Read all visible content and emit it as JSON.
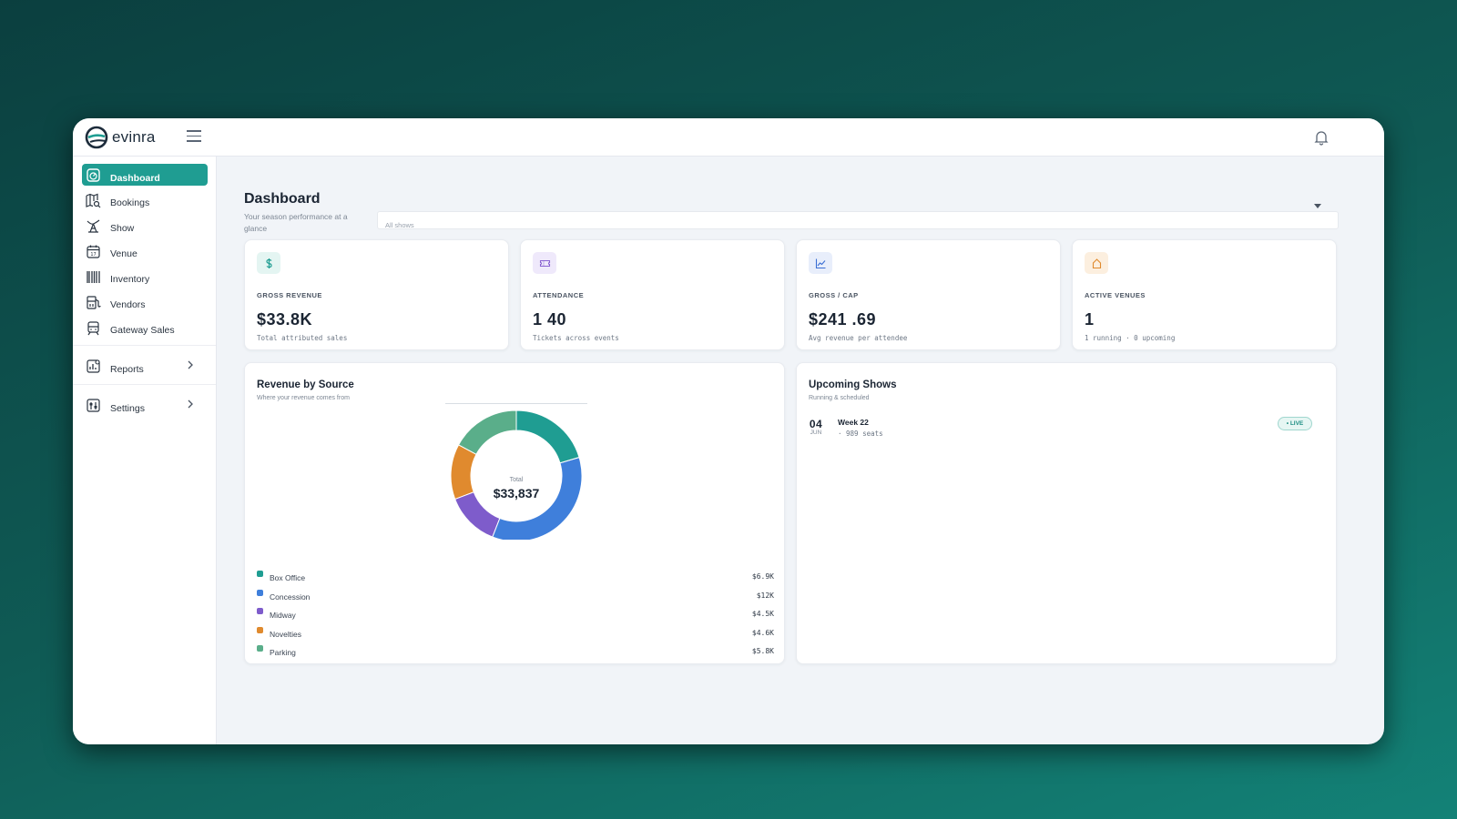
{
  "app": {
    "name": "evinra"
  },
  "sidebar": {
    "items": [
      {
        "label": "Dashboard",
        "icon": "dashboard-icon",
        "active": true
      },
      {
        "label": "Bookings",
        "icon": "map-search-icon"
      },
      {
        "label": "Show",
        "icon": "ferris-wheel-icon"
      },
      {
        "label": "Venue",
        "icon": "calendar-icon"
      },
      {
        "label": "Inventory",
        "icon": "barcode-icon"
      },
      {
        "label": "Vendors",
        "icon": "vendor-pump-icon"
      },
      {
        "label": "Gateway Sales",
        "icon": "tram-icon"
      }
    ],
    "groups": [
      {
        "label": "Reports",
        "icon": "report-chart-icon",
        "expandable": true
      },
      {
        "label": "Settings",
        "icon": "settings-sliders-icon",
        "expandable": true
      }
    ]
  },
  "header": {
    "title": "Dashboard",
    "subtitle": "Your season performance at a glance",
    "filter_value": "All shows"
  },
  "kpis": [
    {
      "label": "GROSS REVENUE",
      "value": "$33.8K",
      "sub": "Total attributed sales",
      "icon": "dollar-icon",
      "color": "#1f9d92",
      "bg": "#e4f5f2"
    },
    {
      "label": "ATTENDANCE",
      "value": "1 40",
      "sub": "Tickets across events",
      "icon": "ticket-icon",
      "color": "#8a63d2",
      "bg": "#efe9fb"
    },
    {
      "label": "GROSS / CAP",
      "value": "$241 .69",
      "sub": "Avg revenue per attendee",
      "icon": "trend-chart-icon",
      "color": "#3b6fd4",
      "bg": "#e8eefb"
    },
    {
      "label": "ACTIVE VENUES",
      "value": "1",
      "sub": "1 running · 0 upcoming",
      "icon": "house-icon",
      "color": "#e08a2e",
      "bg": "#fcefdf"
    }
  ],
  "revenue_panel": {
    "title": "Revenue by Source",
    "subtitle": "Where your revenue comes from",
    "total_label": "Total",
    "total_value": "$33,837"
  },
  "chart_data": {
    "type": "pie",
    "title": "Revenue by Source",
    "categories": [
      "Box Office",
      "Concession",
      "Midway",
      "Novelties",
      "Parking"
    ],
    "values": [
      6900,
      12000,
      4500,
      4600,
      5800
    ],
    "value_labels": [
      "$6.9K",
      "$12K",
      "$4.5K",
      "$4.6K",
      "$5.8K"
    ],
    "colors": [
      "#1f9d92",
      "#3f7fdb",
      "#7e5ccb",
      "#e08a2e",
      "#5aae8a"
    ],
    "legend_position": "bottom",
    "center_label": "$33,837"
  },
  "shows_panel": {
    "title": "Upcoming Shows",
    "subtitle": "Running & scheduled",
    "items": [
      {
        "day": "04",
        "month": "JUN",
        "name": "Week 22",
        "meta": "· 989 seats",
        "status": "• LIVE"
      }
    ]
  }
}
